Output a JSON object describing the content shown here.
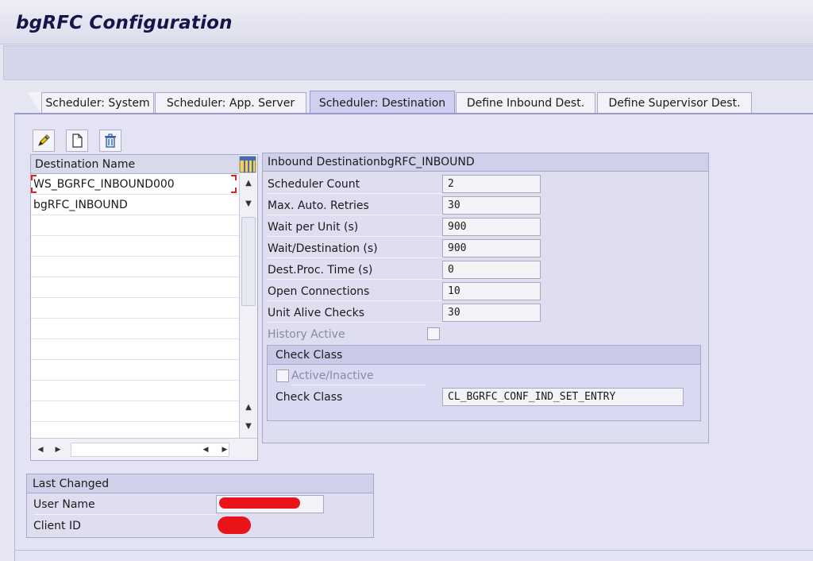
{
  "window": {
    "title": "bgRFC Configuration"
  },
  "tabs": [
    {
      "label": "Scheduler: System",
      "active": false
    },
    {
      "label": "Scheduler: App. Server",
      "active": false
    },
    {
      "label": "Scheduler: Destination",
      "active": true
    },
    {
      "label": "Define Inbound Dest.",
      "active": false
    },
    {
      "label": "Define Supervisor Dest.",
      "active": false
    }
  ],
  "toolbar": {
    "icons": [
      "edit-icon",
      "create-icon",
      "delete-icon"
    ]
  },
  "destination_table": {
    "header": "Destination Name",
    "rows": [
      {
        "name": "WS_BGRFC_INBOUND000",
        "selected": true
      },
      {
        "name": "bgRFC_INBOUND",
        "selected": false
      }
    ]
  },
  "inbound_group": {
    "title": "Inbound DestinationbgRFC_INBOUND",
    "fields": [
      {
        "label": "Scheduler Count",
        "value": "2"
      },
      {
        "label": "Max. Auto. Retries",
        "value": "30"
      },
      {
        "label": "Wait per Unit (s)",
        "value": "900"
      },
      {
        "label": "Wait/Destination (s)",
        "value": "900"
      },
      {
        "label": "Dest.Proc. Time (s)",
        "value": "0"
      },
      {
        "label": "Open Connections",
        "value": "10"
      },
      {
        "label": "Unit Alive Checks",
        "value": "30"
      }
    ],
    "history_active": {
      "label": "History Active",
      "checked": false
    },
    "check_class": {
      "title": "Check Class",
      "active_label": "Active/Inactive",
      "active_checked": false,
      "field_label": "Check Class",
      "field_value": "CL_BGRFC_CONF_IND_SET_ENTRY"
    }
  },
  "last_changed": {
    "title": "Last Changed",
    "user_label": "User Name",
    "client_label": "Client ID"
  },
  "colors": {
    "accent": "#15154a",
    "redaction": "#e8141a",
    "selection_marker": "#dd2222"
  }
}
